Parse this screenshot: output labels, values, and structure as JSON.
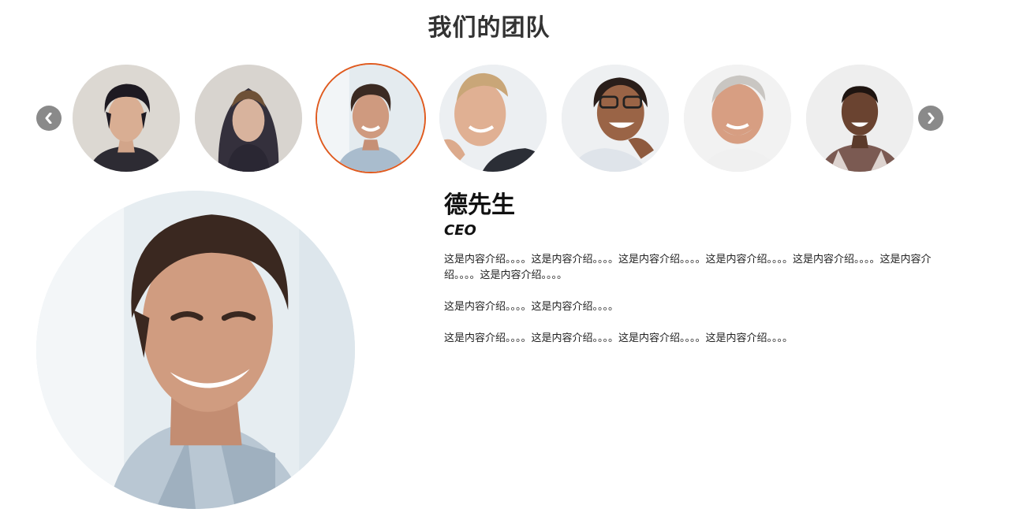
{
  "section": {
    "title": "我们的团队"
  },
  "carousel": {
    "prev_icon": "chevron-left-icon",
    "next_icon": "chevron-right-icon",
    "members": [
      {
        "id": "member-1",
        "icon": "avatar-photo"
      },
      {
        "id": "member-2",
        "icon": "avatar-photo"
      },
      {
        "id": "member-3",
        "icon": "avatar-photo",
        "active": true
      },
      {
        "id": "member-4",
        "icon": "avatar-photo"
      },
      {
        "id": "member-5",
        "icon": "avatar-photo"
      },
      {
        "id": "member-6",
        "icon": "avatar-photo"
      },
      {
        "id": "member-7",
        "icon": "avatar-photo"
      }
    ],
    "active_color": "#e05a1e",
    "arrow_color": "#8a8a8a"
  },
  "detail": {
    "name": "德先生",
    "role": "CEO",
    "paragraphs": [
      "这是内容介绍。。。。这是内容介绍。。。。这是内容介绍。。。。这是内容介绍。。。。这是内容介绍。。。。这是内容介绍。。。。这是内容介绍。。。。",
      "这是内容介绍。。。。这是内容介绍。。。。",
      "这是内容介绍。。。。这是内容介绍。。。。这是内容介绍。。。。这是内容介绍。。。。"
    ]
  }
}
